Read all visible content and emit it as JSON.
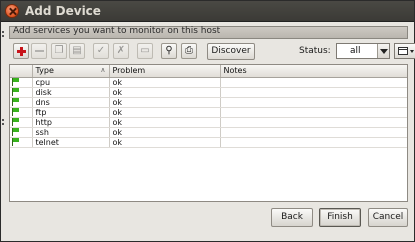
{
  "window": {
    "title": "Add Device"
  },
  "subtitle": "Add services you want to monitor on this host",
  "toolbar": {
    "buttons": [
      {
        "icon": "add-icon",
        "enabled": true
      },
      {
        "icon": "remove-icon",
        "enabled": false
      },
      {
        "icon": "copy-icon",
        "enabled": false
      },
      {
        "icon": "paste-icon",
        "enabled": false
      },
      {
        "icon": "check-icon",
        "enabled": false
      },
      {
        "icon": "uncheck-icon",
        "enabled": false
      },
      {
        "icon": "comment-icon",
        "enabled": false
      },
      {
        "icon": "find-icon",
        "enabled": true
      },
      {
        "icon": "print-icon",
        "enabled": true
      }
    ],
    "discover_label": "Discover",
    "status_label": "Status:",
    "status_value": "all"
  },
  "table": {
    "columns": [
      "",
      "Type",
      "Problem",
      "Notes"
    ],
    "rows": [
      {
        "type": "cpu",
        "problem": "ok",
        "notes": ""
      },
      {
        "type": "disk",
        "problem": "ok",
        "notes": ""
      },
      {
        "type": "dns",
        "problem": "ok",
        "notes": ""
      },
      {
        "type": "ftp",
        "problem": "ok",
        "notes": ""
      },
      {
        "type": "http",
        "problem": "ok",
        "notes": ""
      },
      {
        "type": "ssh",
        "problem": "ok",
        "notes": ""
      },
      {
        "type": "telnet",
        "problem": "ok",
        "notes": ""
      }
    ],
    "status_color": "#37b31d"
  },
  "footer": {
    "back_label": "Back",
    "finish_label": "Finish",
    "cancel_label": "Cancel"
  }
}
